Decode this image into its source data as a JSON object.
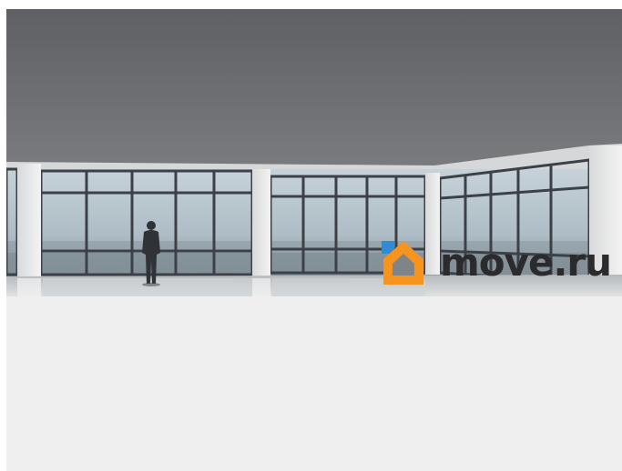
{
  "photo": {
    "subject": "office-interior-with-man-at-windows"
  },
  "watermark": {
    "text": "move.ru",
    "icon": "house-icon",
    "colors": {
      "orange": "#f7941d",
      "blue": "#2e8bd6",
      "text": "#2b2b2d"
    }
  }
}
